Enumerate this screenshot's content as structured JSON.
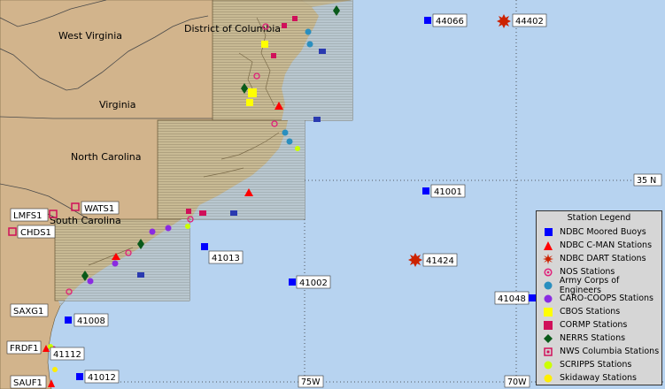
{
  "states": [
    {
      "name": "West Virginia"
    },
    {
      "name": "District of Columbia"
    },
    {
      "name": "Virginia"
    },
    {
      "name": "North Carolina"
    },
    {
      "name": "South Carolina"
    }
  ],
  "grid": {
    "lon_75": "75W",
    "lon_70": "70W",
    "lat_35": "35 N"
  },
  "stations": {
    "ndbc_buoys": [
      "44066",
      "41001",
      "41013",
      "41002",
      "41048",
      "41008",
      "41112",
      "41012"
    ],
    "dart": [
      "44402",
      "41424"
    ],
    "nws_columbia": [
      "WATS1",
      "LMFS1",
      "CHDS1"
    ],
    "cman": [
      "SAXG1",
      "FRDF1",
      "SAUF1"
    ]
  },
  "legend": {
    "title": "Station Legend",
    "items": [
      {
        "label": "NDBC Moored Buoys",
        "symbol": "blue-square",
        "color": "#0000ff"
      },
      {
        "label": "NDBC C-MAN Stations",
        "symbol": "red-triangle",
        "color": "#ff0000"
      },
      {
        "label": "NDBC DART Stations",
        "symbol": "dart-star",
        "color": "#cc2200"
      },
      {
        "label": "NOS Stations",
        "symbol": "nos-ring",
        "color": "#e0207a"
      },
      {
        "label": "Army Corps of Engineers",
        "symbol": "teal-circle",
        "color": "#2a8fbf"
      },
      {
        "label": "CARO-COOPS Stations",
        "symbol": "purple-circle",
        "color": "#8a2be2"
      },
      {
        "label": "CBOS Stations",
        "symbol": "yellow-square",
        "color": "#ffff00"
      },
      {
        "label": "CORMP Stations",
        "symbol": "crimson-square",
        "color": "#d0105a"
      },
      {
        "label": "NERRS Stations",
        "symbol": "green-diamond",
        "color": "#0a5a1a"
      },
      {
        "label": "NWS Columbia Stations",
        "symbol": "pink-box",
        "color": "#d0105a"
      },
      {
        "label": "SCRIPPS Stations",
        "symbol": "lime-circle",
        "color": "#ccff00"
      },
      {
        "label": "Skidaway Stations",
        "symbol": "gold-circle",
        "color": "#ffee00"
      }
    ]
  },
  "colors": {
    "ocean": "#b7d3f0",
    "land": "#d2b48c",
    "highlight_box": "#c9bd99"
  }
}
